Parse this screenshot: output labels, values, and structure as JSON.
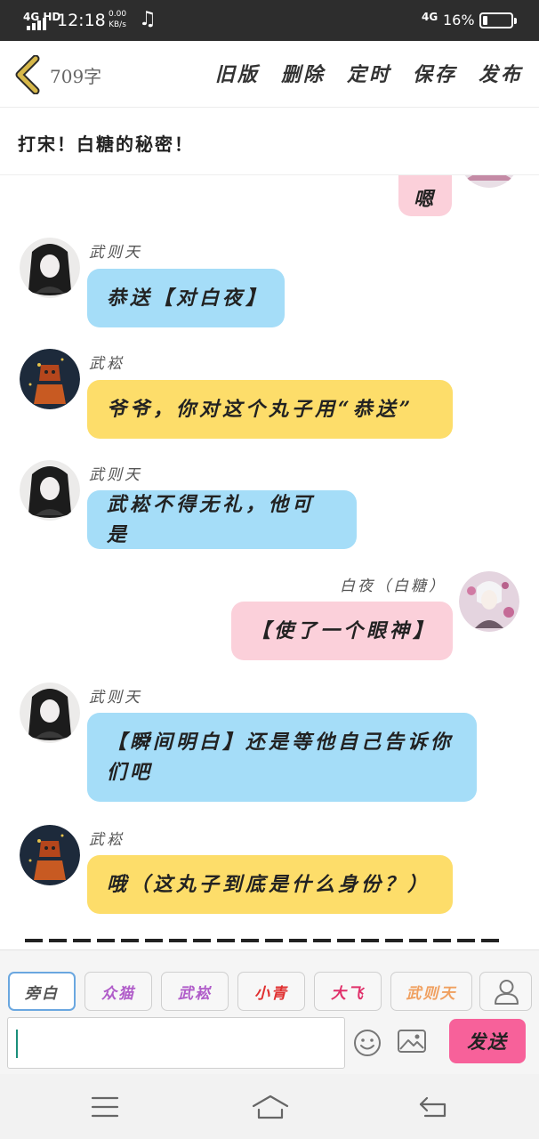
{
  "status_bar": {
    "signal": "4G HD",
    "time": "12:18",
    "speed_value": "0.00",
    "speed_unit": "KB/s",
    "network": "4G",
    "battery_percent": "16%",
    "battery_level": 0.16
  },
  "header": {
    "word_count": "709字",
    "actions": [
      "旧版",
      "删除",
      "定时",
      "保存",
      "发布"
    ]
  },
  "story": {
    "title": "打宋！白糖的秘密！"
  },
  "messages": [
    {
      "side": "right",
      "speaker": "",
      "text": "嗯",
      "color": "pink"
    },
    {
      "side": "left",
      "speaker": "武则天",
      "text": "恭送【对白夜】",
      "color": "blue"
    },
    {
      "side": "left",
      "speaker": "武崧",
      "text": "爷爷，你对这个丸子用“恭送”",
      "color": "yellow"
    },
    {
      "side": "left",
      "speaker": "武则天",
      "text": "武崧不得无礼，他可是",
      "color": "blue"
    },
    {
      "side": "right",
      "speaker": "白夜（白糖）",
      "text": "【使了一个眼神】",
      "color": "pink"
    },
    {
      "side": "left",
      "speaker": "武则天",
      "text": "【瞬间明白】还是等他自己告诉你们吧",
      "color": "blue"
    },
    {
      "side": "left",
      "speaker": "武崧",
      "text": "哦（这丸子到底是什么身份？）",
      "color": "yellow"
    }
  ],
  "characters": [
    {
      "label": "旁白",
      "color": "#555555"
    },
    {
      "label": "众猫",
      "color": "#b05cc9"
    },
    {
      "label": "武崧",
      "color": "#b05cc9"
    },
    {
      "label": "小青",
      "color": "#e03030"
    },
    {
      "label": "大飞",
      "color": "#e0306a"
    },
    {
      "label": "武则天",
      "color": "#f0a060"
    }
  ],
  "composer": {
    "input_value": "",
    "send_label": "发送"
  },
  "colors": {
    "blue_bubble": "#a5ddf8",
    "yellow_bubble": "#fddd6a",
    "pink_bubble": "#fbd0da",
    "send_button": "#f7619a",
    "back_chevron": "#d7b84a"
  },
  "icons": [
    "back-chevron-icon",
    "music-note-icon",
    "battery-icon",
    "user-icon",
    "emoji-icon",
    "image-icon",
    "menu-icon",
    "home-icon",
    "back-icon"
  ]
}
